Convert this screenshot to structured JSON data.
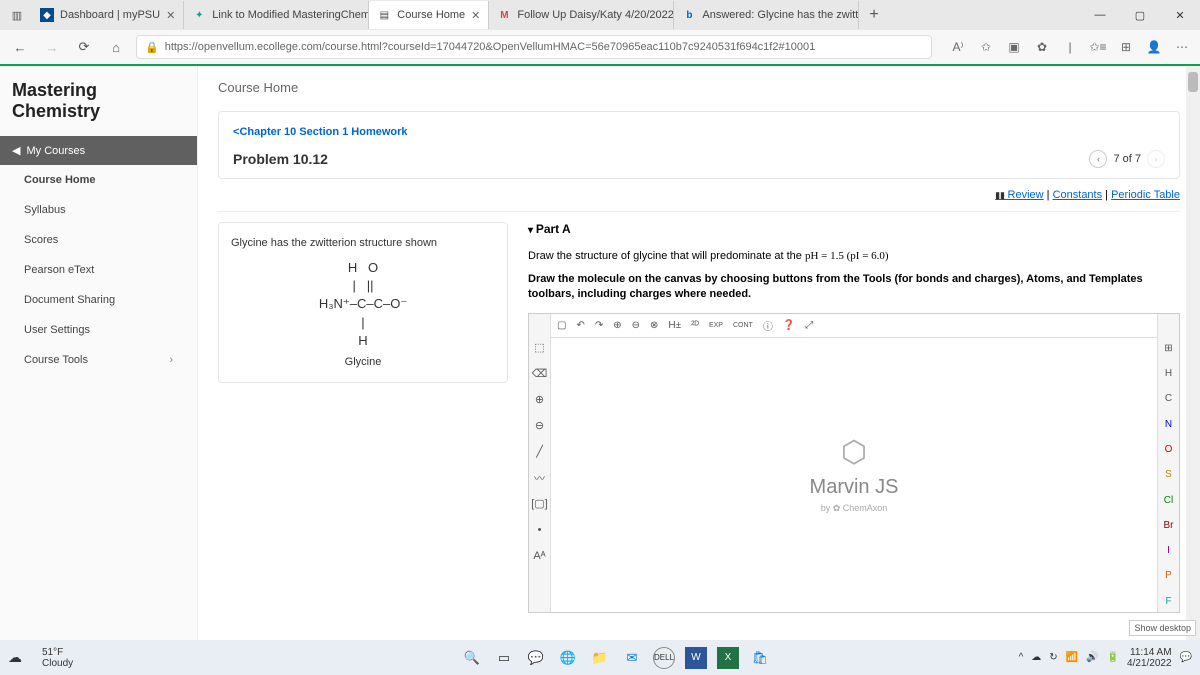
{
  "browser": {
    "tabs": [
      {
        "title": "Dashboard | myPSU",
        "icon": "◆"
      },
      {
        "title": "Link to Modified MasteringChem",
        "icon": "✦"
      },
      {
        "title": "Course Home",
        "icon": "▤",
        "active": true
      },
      {
        "title": "Follow Up Daisy/Katy 4/20/2022",
        "icon": "M"
      },
      {
        "title": "Answered: Glycine has the zwitte",
        "icon": "b"
      }
    ],
    "url": "https://openvellum.ecollege.com/course.html?courseId=17044720&OpenVellumHMAC=56e70965eac110b7c9240531f694c1f2#10001"
  },
  "app": {
    "brand": "Mastering Chemistry",
    "my_courses": "My Courses",
    "nav": [
      "Course Home",
      "Syllabus",
      "Scores",
      "Pearson eText",
      "Document Sharing",
      "User Settings",
      "Course Tools"
    ],
    "content_title": "Course Home"
  },
  "assignment": {
    "back": "Chapter 10 Section 1 Homework",
    "problem": "Problem 10.12",
    "pager": "7 of 7",
    "links": {
      "review": "Review",
      "constants": "Constants",
      "periodic": "Periodic Table"
    }
  },
  "left_panel": {
    "text": "Glycine has the zwitterion structure shown",
    "mol_line1": "H   O",
    "mol_line2": "|   ||",
    "mol_line3": "H₃N⁺–C–C–O⁻",
    "mol_line4": "|",
    "mol_line5": "H",
    "mol_name": "Glycine"
  },
  "part": {
    "title": "Part A",
    "instr1_pre": "Draw the structure of glycine that will predominate at the ",
    "instr1_eq": "pH = 1.5 (pI = 6.0)",
    "instr2": "Draw the molecule on the canvas by choosing buttons from the Tools (for bonds and charges), Atoms, and Templates toolbars, including charges where needed."
  },
  "marvin": {
    "name": "Marvin JS",
    "by_pre": "by ",
    "by": "ChemAxon",
    "top_tools": [
      "▢",
      "↶",
      "↷",
      "⊕",
      "⊖",
      "⊗",
      "H±",
      "²ᴰ",
      "EXP",
      "CONT",
      "ⓘ",
      "❓",
      "⤢"
    ],
    "left_tools": [
      "⬚",
      "⌫",
      "⊕",
      "⊖",
      "╱",
      "〰",
      "[▢]",
      "•",
      "Aᴬ"
    ],
    "atoms": [
      "⊞",
      "H",
      "C",
      "N",
      "O",
      "S",
      "Cl",
      "Br",
      "I",
      "P",
      "F"
    ]
  },
  "taskbar": {
    "temp": "51°F",
    "cond": "Cloudy",
    "time": "11:14 AM",
    "date": "4/21/2022",
    "show_desktop": "Show desktop"
  }
}
